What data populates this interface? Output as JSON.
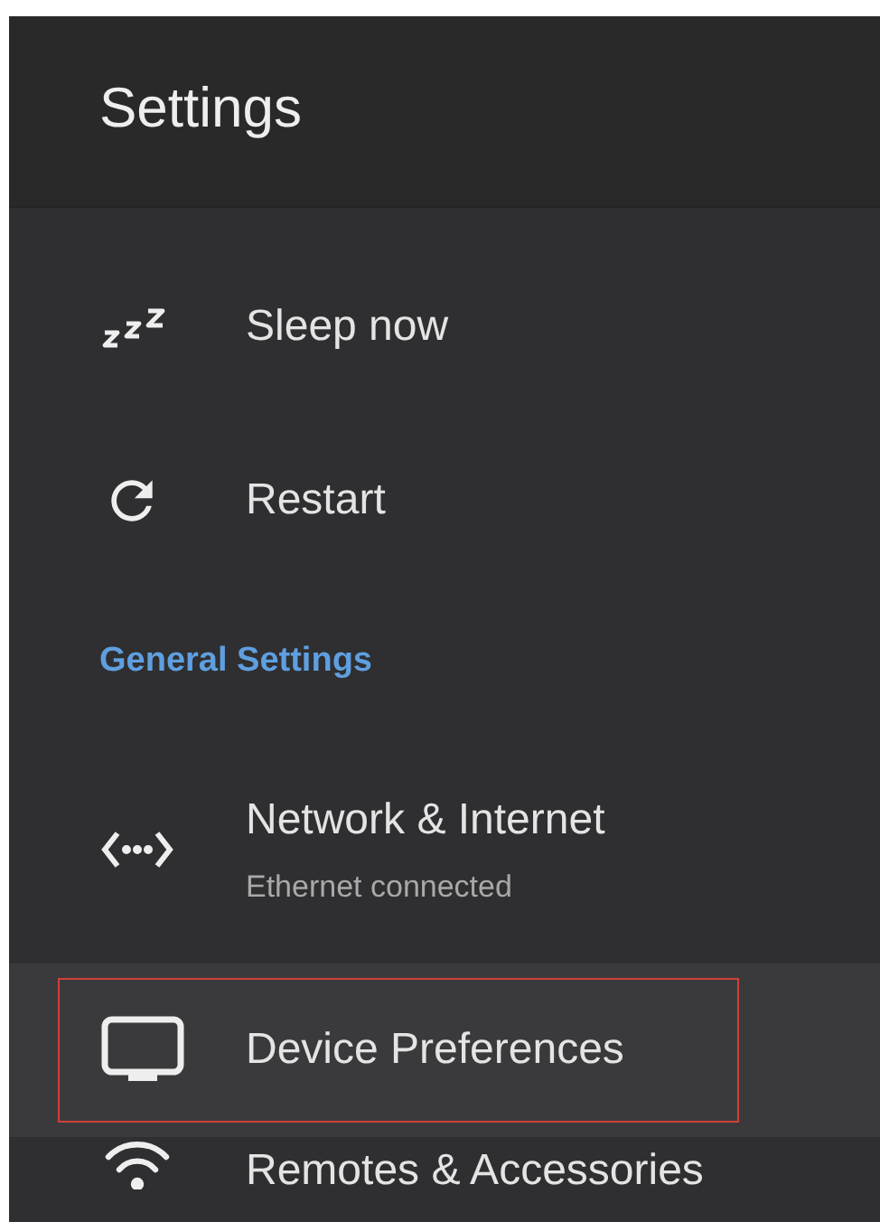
{
  "header": {
    "title": "Settings"
  },
  "items": [
    {
      "kind": "item",
      "label": "Sleep now",
      "selected": false
    },
    {
      "kind": "item",
      "label": "Restart",
      "selected": false
    },
    {
      "kind": "section",
      "label": "General Settings"
    },
    {
      "kind": "item",
      "label": "Network & Internet",
      "subtitle": "Ethernet connected",
      "selected": false
    },
    {
      "kind": "item",
      "label": "Device Preferences",
      "selected": true
    },
    {
      "kind": "item",
      "label": "Remotes & Accessories",
      "selected": false
    }
  ]
}
